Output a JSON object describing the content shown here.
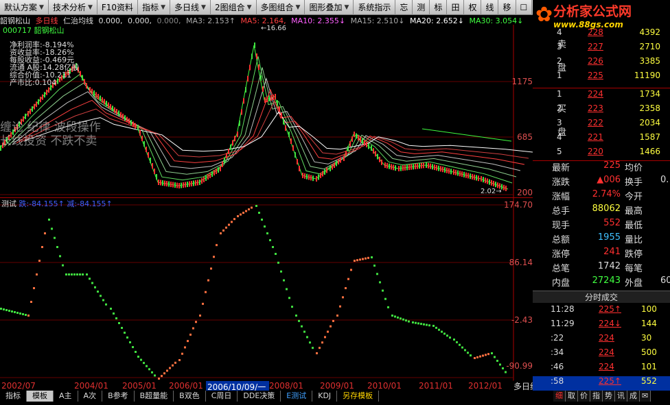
{
  "toolbar": {
    "items": [
      {
        "label": "默认方案",
        "caret": "▼"
      },
      {
        "label": "技术分析",
        "caret": "▼"
      },
      {
        "label": "F10资料",
        "caret": ""
      },
      {
        "label": "指标",
        "caret": "▼"
      },
      {
        "label": "多日线",
        "caret": "▼"
      },
      {
        "label": "2图组合",
        "caret": "▼"
      },
      {
        "label": "多图组合",
        "caret": "▼"
      },
      {
        "label": "图形叠加",
        "caret": "▼"
      },
      {
        "label": "系统指示",
        "caret": ""
      },
      {
        "label": "忘",
        "caret": ""
      },
      {
        "label": "测",
        "caret": ""
      },
      {
        "label": "标",
        "caret": ""
      },
      {
        "label": "田",
        "caret": ""
      },
      {
        "label": "权",
        "caret": ""
      },
      {
        "label": "线",
        "caret": ""
      },
      {
        "label": "移",
        "caret": ""
      },
      {
        "label": "☐",
        "caret": ""
      }
    ]
  },
  "logo": {
    "title": "分析家公式网",
    "url": "www.88gs.com"
  },
  "infobar": {
    "stock": "韶钢松山",
    "period": "多日线",
    "indicator": "仁治均线",
    "p1": "0.000,",
    "p2": "0.000,",
    "p3": "0.000,",
    "ma3": "MA3: 2.153↑",
    "ma5": "MA5: 2.164,",
    "ma10": "MA10: 2.355↓",
    "ma15": "MA15: 2.510↓",
    "ma20": "MA20: 2.652↓",
    "ma30": "MA30: 3.054↓"
  },
  "stock_code": "000717  韶钢松山",
  "fundamentals": [
    "净利润率:-8.194%",
    "资收益率:-18.26%",
    "每股收益:-0.469元",
    "流通 A股:14.28亿股",
    "综合价值:-10.211",
    "产市比:0.104"
  ],
  "watermark": [
    "缠论 纪律 波段操作",
    "长线投资 不跌不卖"
  ],
  "main_axis": [
    "1175",
    "685",
    "200"
  ],
  "peak_label": "16.66",
  "low_label": "2.02",
  "indicator_label": "测试",
  "indicator_values": {
    "a": "跌:-84.155↑",
    "b": "减:-84.155↑"
  },
  "ind_axis": [
    "174.70",
    "86.14",
    "-2.43",
    "-90.99"
  ],
  "ind_marker": "32",
  "dates": [
    "2002/07",
    "2004/01",
    "2005/01",
    "2006/01",
    "2008/01",
    "2009/01",
    "2010/01",
    "2011/01",
    "2012/01"
  ],
  "crosshair_date": "2006/10/09/一",
  "period_box": "多日线",
  "orderbook": {
    "sell_label": "卖盘",
    "buy_label": "买盘",
    "sell": [
      {
        "lv": "4",
        "price": "228",
        "vol": "4392"
      },
      {
        "lv": "3",
        "price": "227",
        "vol": "2710"
      },
      {
        "lv": "2",
        "price": "226",
        "vol": "3385"
      },
      {
        "lv": "1",
        "price": "225",
        "vol": "11190"
      }
    ],
    "buy": [
      {
        "lv": "1",
        "price": "224",
        "vol": "1734"
      },
      {
        "lv": "2",
        "price": "223",
        "vol": "2358"
      },
      {
        "lv": "3",
        "price": "222",
        "vol": "2034"
      },
      {
        "lv": "4",
        "price": "221",
        "vol": "1587"
      },
      {
        "lv": "5",
        "price": "220",
        "vol": "1466"
      }
    ]
  },
  "stats": [
    {
      "k": "最新",
      "v": "225",
      "vc": "#ff3030",
      "k2": "均价",
      "v2": ""
    },
    {
      "k": "涨跌",
      "v": "▲006",
      "vc": "#ff3030",
      "k2": "换手",
      "v2": "0."
    },
    {
      "k": "涨幅",
      "v": "2.74%",
      "vc": "#ff3030",
      "k2": "今开",
      "v2": ""
    },
    {
      "k": "总手",
      "v": "88062",
      "vc": "#ffff40",
      "k2": "最高",
      "v2": ""
    },
    {
      "k": "现手",
      "v": "552",
      "vc": "#ff3030",
      "k2": "最低",
      "v2": ""
    },
    {
      "k": "总额",
      "v": "1955",
      "vc": "#40c0ff",
      "k2": "量比",
      "v2": ""
    },
    {
      "k": "涨停",
      "v": "241",
      "vc": "#ff3030",
      "k2": "跌停",
      "v2": ""
    },
    {
      "k": "总笔",
      "v": "1742",
      "vc": "#ddd",
      "k2": "每笔",
      "v2": ""
    },
    {
      "k": "内盘",
      "v": "27243",
      "vc": "#40ff40",
      "k2": "外盘",
      "v2": "60"
    }
  ],
  "ticks_title": "分时成交",
  "ticks": [
    {
      "t": "11:28",
      "p": "225↑",
      "pc": "#ff3030",
      "q": "100"
    },
    {
      "t": "11:29",
      "p": "224↓",
      "pc": "#ff3030",
      "q": "144"
    },
    {
      "t": ":22",
      "p": "224",
      "pc": "#ff3030",
      "q": "30"
    },
    {
      "t": ":34",
      "p": "224",
      "pc": "#ff3030",
      "q": "500"
    },
    {
      "t": ":46",
      "p": "224",
      "pc": "#ff3030",
      "q": "101"
    },
    {
      "t": ":58",
      "p": "225↑",
      "pc": "#ff3030",
      "q": "552"
    }
  ],
  "bottom_tabs": [
    "指标",
    "模板",
    "A主",
    "A次",
    "B参考",
    "B超量能",
    "B双色",
    "C周日",
    "DDE决策",
    "E测试",
    "KDJ",
    "另存模板"
  ],
  "right_tabs": [
    "细",
    "取",
    "价",
    "指",
    "势",
    "讯",
    "成",
    "✉"
  ]
}
